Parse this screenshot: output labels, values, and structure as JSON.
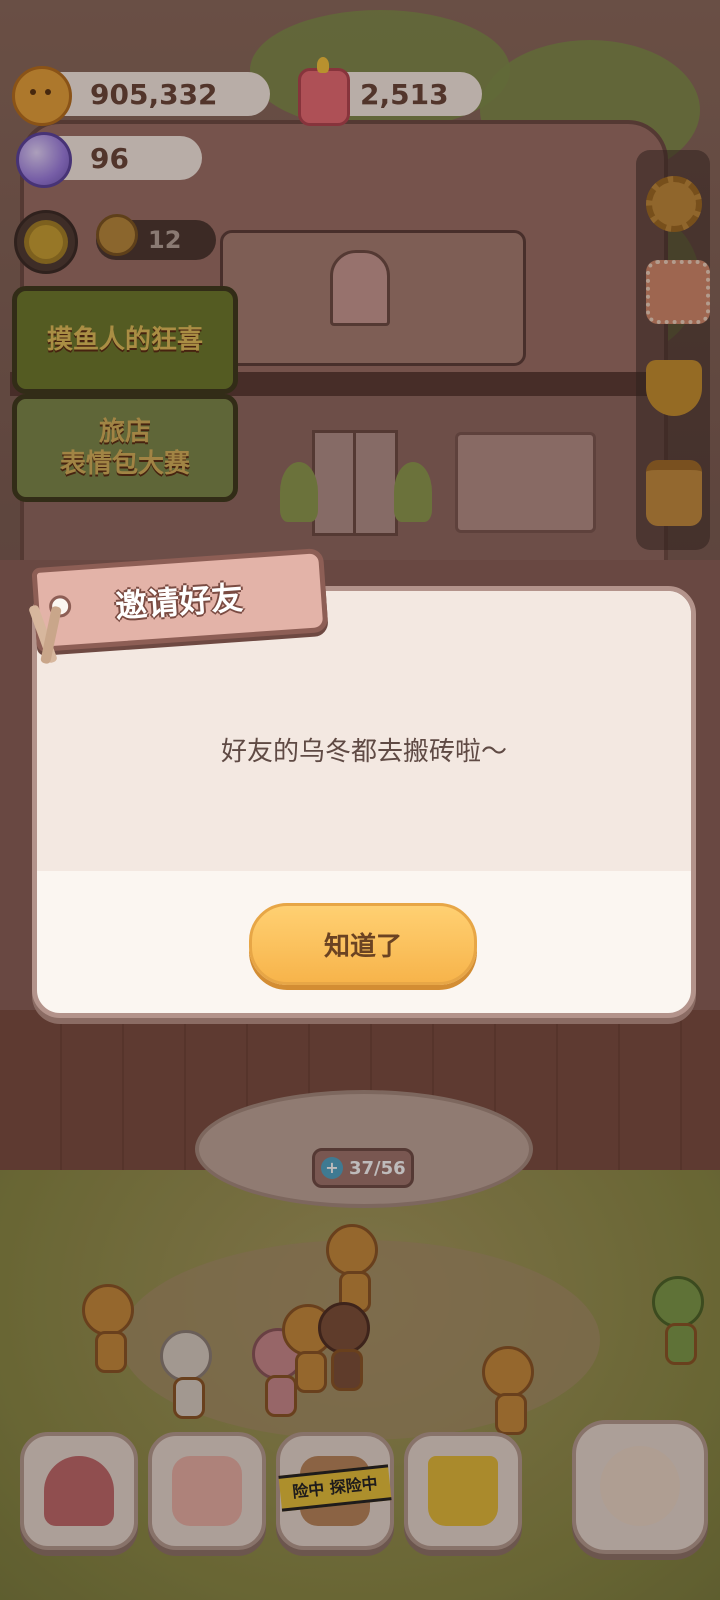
{
  "hud": {
    "coins": "905,332",
    "candies": "2,513",
    "gems": "96",
    "slot_count": "12"
  },
  "events": {
    "banner_1": "摸鱼人的狂喜",
    "banner_2_line1": "旅店",
    "banner_2_line2": "表情包大赛"
  },
  "dialog": {
    "title": "邀请好友",
    "message": "好友的乌冬都去搬砖啦～",
    "confirm_label": "知道了"
  },
  "counter": {
    "value": "37/56"
  },
  "bottom_nav": {
    "explore_tape_text": "险中 探险中"
  }
}
